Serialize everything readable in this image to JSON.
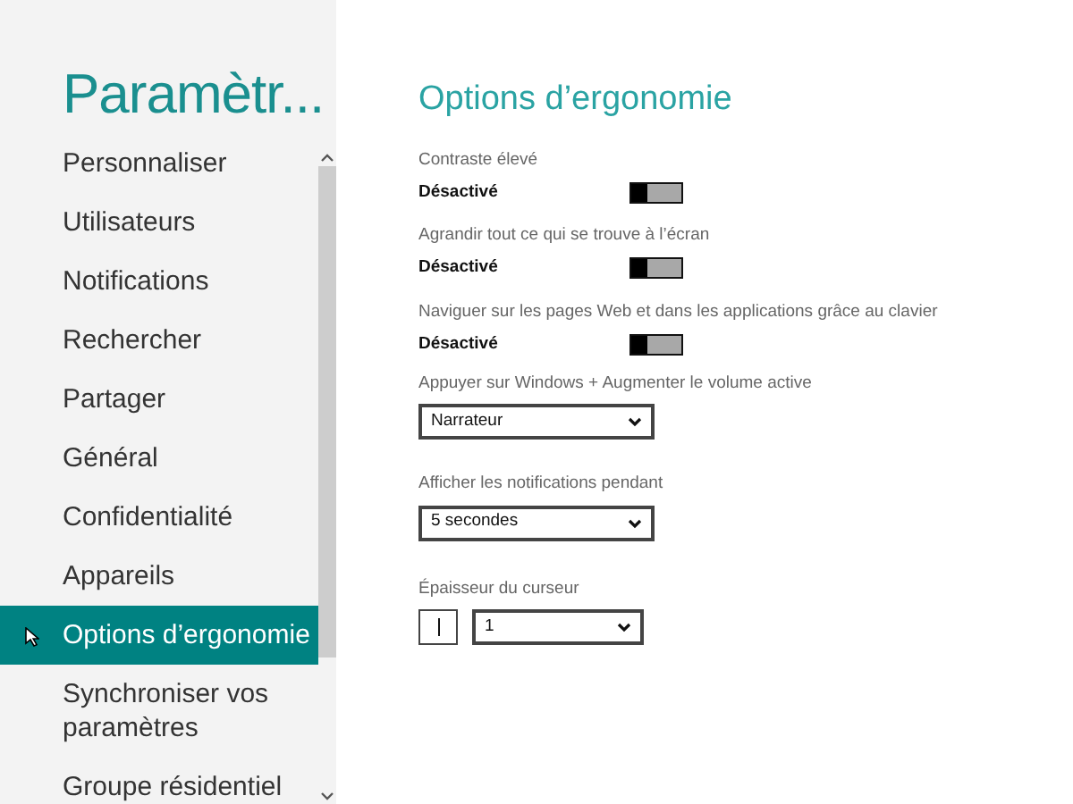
{
  "sidebar": {
    "title": "Paramètr...",
    "items": [
      {
        "label": "Personnaliser",
        "selected": false
      },
      {
        "label": "Utilisateurs",
        "selected": false
      },
      {
        "label": "Notifications",
        "selected": false
      },
      {
        "label": "Rechercher",
        "selected": false
      },
      {
        "label": "Partager",
        "selected": false
      },
      {
        "label": "Général",
        "selected": false
      },
      {
        "label": "Confidentialité",
        "selected": false
      },
      {
        "label": "Appareils",
        "selected": false
      },
      {
        "label": "Options d’ergonomie",
        "selected": true
      },
      {
        "label": "Synchroniser vos paramètres",
        "selected": false
      },
      {
        "label": "Groupe résidentiel",
        "selected": false
      }
    ]
  },
  "page": {
    "title": "Options d’ergonomie",
    "settings": [
      {
        "kind": "toggle",
        "label": "Contraste élevé",
        "state": "Désactivé",
        "on": false
      },
      {
        "kind": "toggle",
        "label": "Agrandir tout ce qui se trouve à l’écran",
        "state": "Désactivé",
        "on": false
      },
      {
        "kind": "toggle",
        "label": "Naviguer sur les pages Web et dans les applications grâce au clavier",
        "state": "Désactivé",
        "on": false
      },
      {
        "kind": "select",
        "label": "Appuyer sur Windows + Augmenter le volume active",
        "value": "Narrateur"
      },
      {
        "kind": "select",
        "label": "Afficher les notifications pendant",
        "value": "5 secondes"
      },
      {
        "kind": "cursor",
        "label": "Épaisseur du curseur",
        "value": "1"
      }
    ]
  }
}
